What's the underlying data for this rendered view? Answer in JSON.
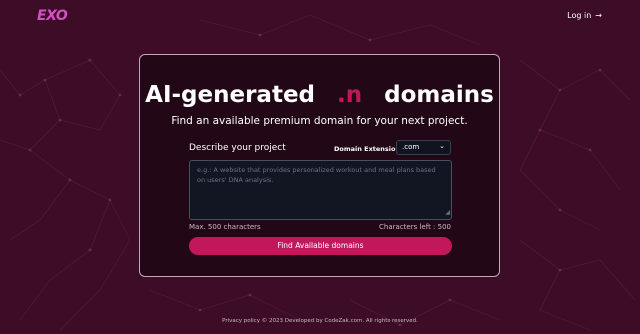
{
  "header": {
    "logo": "EXO",
    "login_label": "Log in",
    "login_arrow": "→"
  },
  "hero": {
    "title_start": "AI-generated",
    "title_ext": ".n",
    "title_end": "domains",
    "subtitle": "Find an available premium domain for your next project."
  },
  "form": {
    "describe_label": "Describe your project",
    "extension_label": "Domain Extension",
    "extension_value": ".com",
    "placeholder": "e.g.: A website that provides personalized workout and meal plans based on users' DNA analysis.",
    "max_chars": "Max. 500 characters",
    "chars_left": "Characters left : 500",
    "submit_label": "Find Available domains"
  },
  "footer": {
    "text": "Privacy policy © 2023 Developed by CodeZak.com. All rights reserved."
  },
  "colors": {
    "background": "#3d0c26",
    "accent": "#c2185b",
    "logo": "#d64fc7"
  }
}
